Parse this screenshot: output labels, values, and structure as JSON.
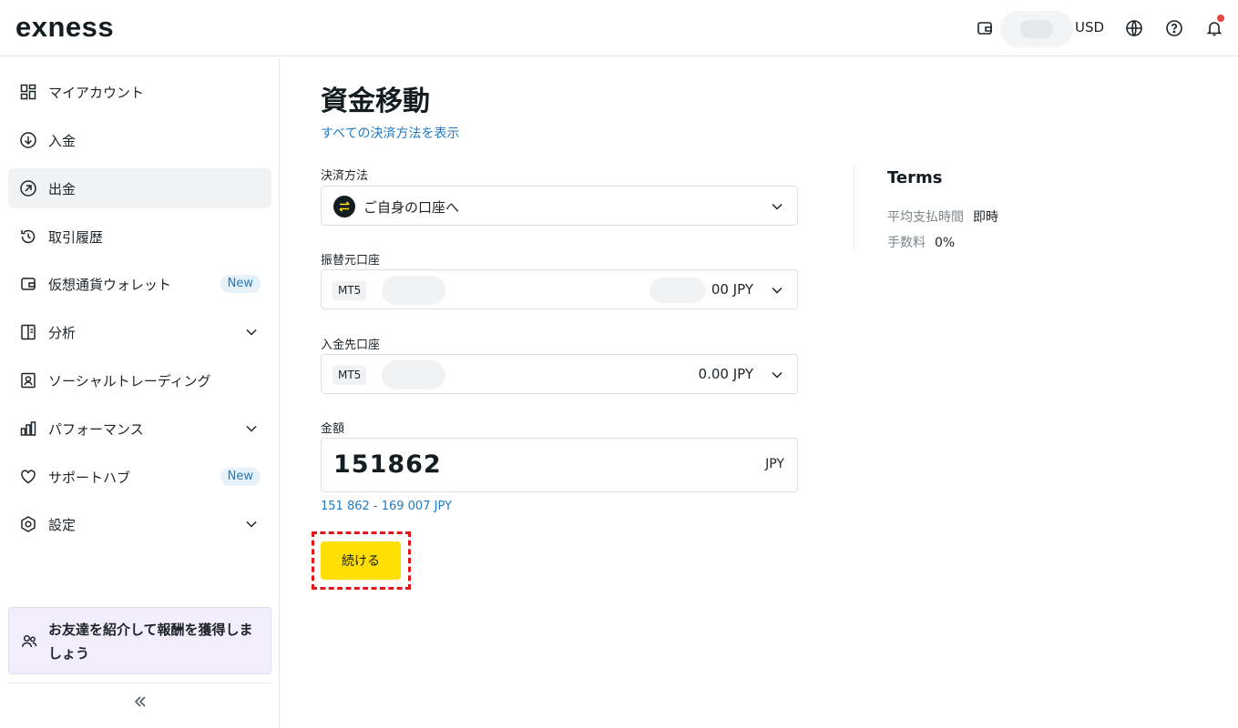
{
  "header": {
    "logo": "exness",
    "currency": "USD"
  },
  "sidebar": {
    "items": [
      {
        "label": "マイアカウント",
        "icon": "dashboard-icon"
      },
      {
        "label": "入金",
        "icon": "deposit-icon"
      },
      {
        "label": "出金",
        "icon": "withdraw-icon",
        "active": true
      },
      {
        "label": "取引履歴",
        "icon": "history-icon"
      },
      {
        "label": "仮想通貨ウォレット",
        "icon": "wallet-icon",
        "badge": "New"
      },
      {
        "label": "分析",
        "icon": "analytics-icon",
        "expandable": true
      },
      {
        "label": "ソーシャルトレーディング",
        "icon": "social-trading-icon"
      },
      {
        "label": "パフォーマンス",
        "icon": "performance-icon",
        "expandable": true
      },
      {
        "label": "サポートハブ",
        "icon": "heart-icon",
        "badge": "New"
      },
      {
        "label": "設定",
        "icon": "settings-icon",
        "expandable": true
      }
    ],
    "promo": "お友達を紹介して報酬を獲得しましょう"
  },
  "main": {
    "title": "資金移動",
    "all_methods_link": "すべての決済方法を表示",
    "payment_method": {
      "label": "決済方法",
      "value": "ご自身の口座へ"
    },
    "from_account": {
      "label": "振替元口座",
      "tag": "MT5",
      "amount": "00 JPY"
    },
    "to_account": {
      "label": "入金先口座",
      "tag": "MT5",
      "amount": "0.00 JPY"
    },
    "amount": {
      "label": "金額",
      "value": "151862",
      "currency": "JPY",
      "range": "151 862 - 169 007 JPY"
    },
    "continue_label": "続ける"
  },
  "terms": {
    "title": "Terms",
    "rows": [
      {
        "key": "平均支払時間",
        "value": "即時"
      },
      {
        "key": "手数料",
        "value": "0%"
      }
    ]
  },
  "colors": {
    "accent": "#ffde02",
    "link": "#1f7ac4",
    "highlight": "#e0161b",
    "promo_bg": "#f3eefe"
  }
}
